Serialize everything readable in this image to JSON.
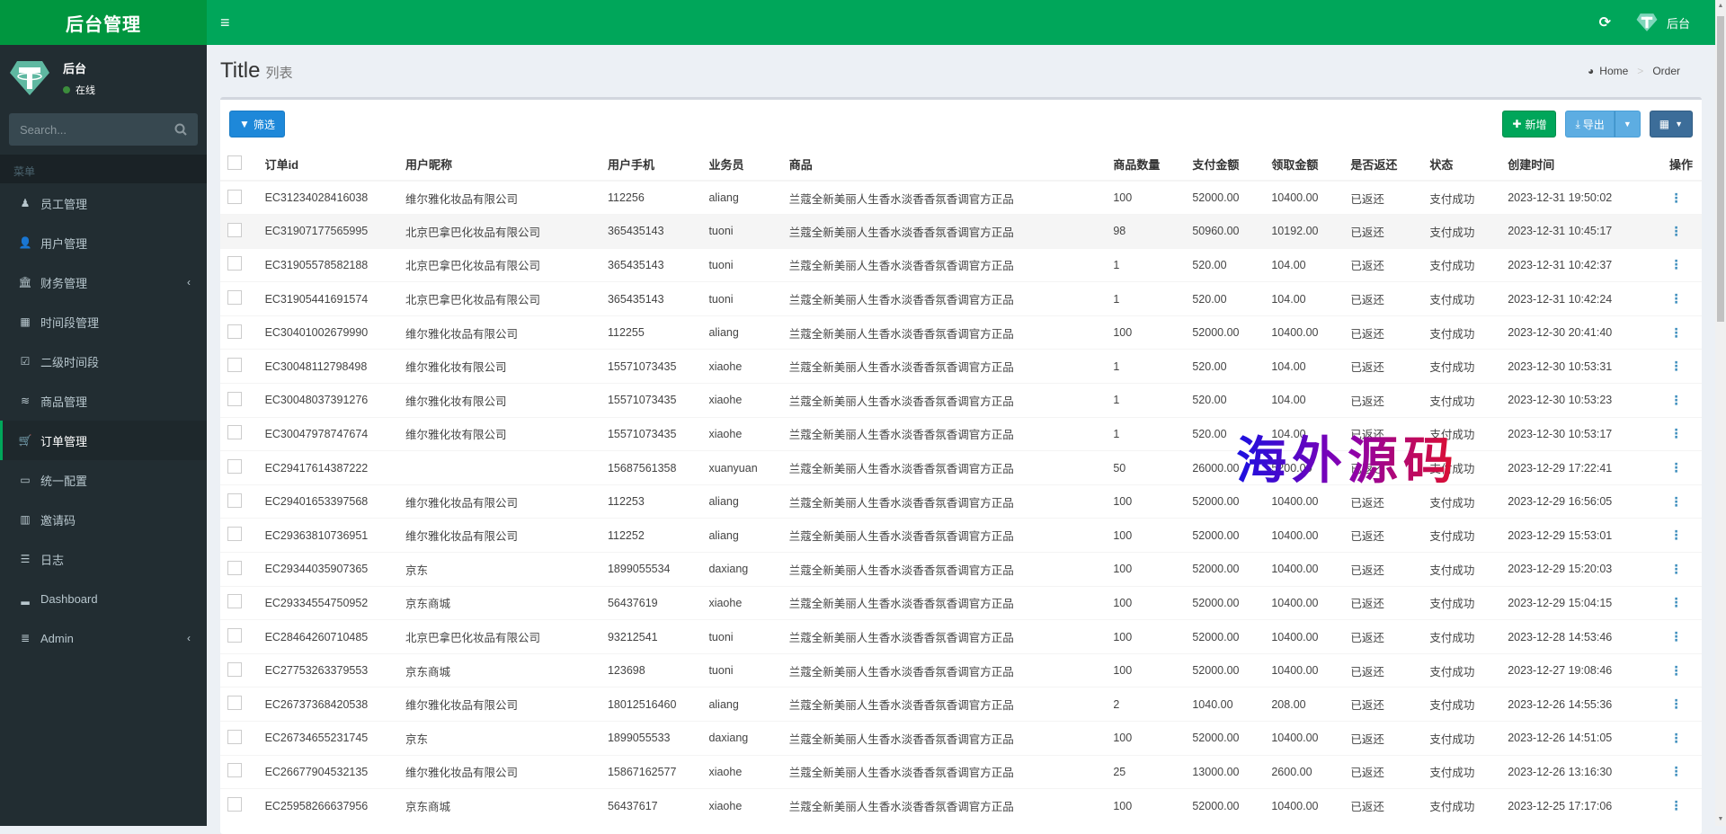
{
  "app": {
    "logo": "后台管理"
  },
  "user_panel": {
    "name": "后台",
    "status": "在线"
  },
  "sidebar": {
    "search_placeholder": "Search...",
    "header": "菜单",
    "items": [
      {
        "label": "员工管理",
        "icon": "user-tie-icon"
      },
      {
        "label": "用户管理",
        "icon": "user-icon"
      },
      {
        "label": "财务管理",
        "icon": "bank-icon",
        "chevron": "‹"
      },
      {
        "label": "时间段管理",
        "icon": "calendar-icon"
      },
      {
        "label": "二级时间段",
        "icon": "calendar-check-icon"
      },
      {
        "label": "商品管理",
        "icon": "database-icon"
      },
      {
        "label": "订单管理",
        "icon": "cart-icon",
        "active": true
      },
      {
        "label": "统一配置",
        "icon": "desktop-icon"
      },
      {
        "label": "邀请码",
        "icon": "building-icon"
      },
      {
        "label": "日志",
        "icon": "list-icon"
      },
      {
        "label": "Dashboard",
        "icon": "bar-chart-icon"
      },
      {
        "label": "Admin",
        "icon": "server-icon",
        "chevron": "‹"
      }
    ]
  },
  "topbar": {
    "user_name": "后台"
  },
  "page": {
    "title": "Title",
    "subtitle": "列表",
    "breadcrumb": [
      "Home",
      "Order"
    ]
  },
  "toolbar": {
    "filter_label": "筛选",
    "add_label": "新增",
    "export_label": "导出"
  },
  "table": {
    "columns": [
      "订单id",
      "用户昵称",
      "用户手机",
      "业务员",
      "商品",
      "商品数量",
      "支付金额",
      "领取金额",
      "是否返还",
      "状态",
      "创建时间",
      "操作"
    ],
    "rows": [
      [
        "EC31234028416038",
        "维尔雅化妆品有限公司",
        "112256",
        "aliang",
        "兰蔻全新美丽人生香水淡香香氛香调官方正品",
        "100",
        "52000.00",
        "10400.00",
        "已返还",
        "支付成功",
        "2023-12-31 19:50:02"
      ],
      [
        "EC31907177565995",
        "北京巴拿巴化妆品有限公司",
        "365435143",
        "tuoni",
        "兰蔻全新美丽人生香水淡香香氛香调官方正品",
        "98",
        "50960.00",
        "10192.00",
        "已返还",
        "支付成功",
        "2023-12-31 10:45:17"
      ],
      [
        "EC31905578582188",
        "北京巴拿巴化妆品有限公司",
        "365435143",
        "tuoni",
        "兰蔻全新美丽人生香水淡香香氛香调官方正品",
        "1",
        "520.00",
        "104.00",
        "已返还",
        "支付成功",
        "2023-12-31 10:42:37"
      ],
      [
        "EC31905441691574",
        "北京巴拿巴化妆品有限公司",
        "365435143",
        "tuoni",
        "兰蔻全新美丽人生香水淡香香氛香调官方正品",
        "1",
        "520.00",
        "104.00",
        "已返还",
        "支付成功",
        "2023-12-31 10:42:24"
      ],
      [
        "EC30401002679990",
        "维尔雅化妆品有限公司",
        "112255",
        "aliang",
        "兰蔻全新美丽人生香水淡香香氛香调官方正品",
        "100",
        "52000.00",
        "10400.00",
        "已返还",
        "支付成功",
        "2023-12-30 20:41:40"
      ],
      [
        "EC30048112798498",
        "维尔雅化妆有限公司",
        "15571073435",
        "xiaohe",
        "兰蔻全新美丽人生香水淡香香氛香调官方正品",
        "1",
        "520.00",
        "104.00",
        "已返还",
        "支付成功",
        "2023-12-30 10:53:31"
      ],
      [
        "EC30048037391276",
        "维尔雅化妆有限公司",
        "15571073435",
        "xiaohe",
        "兰蔻全新美丽人生香水淡香香氛香调官方正品",
        "1",
        "520.00",
        "104.00",
        "已返还",
        "支付成功",
        "2023-12-30 10:53:23"
      ],
      [
        "EC30047978747674",
        "维尔雅化妆有限公司",
        "15571073435",
        "xiaohe",
        "兰蔻全新美丽人生香水淡香香氛香调官方正品",
        "1",
        "520.00",
        "104.00",
        "已返还",
        "支付成功",
        "2023-12-30 10:53:17"
      ],
      [
        "EC29417614387222",
        "",
        "15687561358",
        "xuanyuan",
        "兰蔻全新美丽人生香水淡香香氛香调官方正品",
        "50",
        "26000.00",
        "5200.00",
        "已返还",
        "支付成功",
        "2023-12-29 17:22:41"
      ],
      [
        "EC29401653397568",
        "维尔雅化妆品有限公司",
        "112253",
        "aliang",
        "兰蔻全新美丽人生香水淡香香氛香调官方正品",
        "100",
        "52000.00",
        "10400.00",
        "已返还",
        "支付成功",
        "2023-12-29 16:56:05"
      ],
      [
        "EC29363810736951",
        "维尔雅化妆品有限公司",
        "112252",
        "aliang",
        "兰蔻全新美丽人生香水淡香香氛香调官方正品",
        "100",
        "52000.00",
        "10400.00",
        "已返还",
        "支付成功",
        "2023-12-29 15:53:01"
      ],
      [
        "EC29344035907365",
        "京东",
        "1899055534",
        "daxiang",
        "兰蔻全新美丽人生香水淡香香氛香调官方正品",
        "100",
        "52000.00",
        "10400.00",
        "已返还",
        "支付成功",
        "2023-12-29 15:20:03"
      ],
      [
        "EC29334554750952",
        "京东商城",
        "56437619",
        "xiaohe",
        "兰蔻全新美丽人生香水淡香香氛香调官方正品",
        "100",
        "52000.00",
        "10400.00",
        "已返还",
        "支付成功",
        "2023-12-29 15:04:15"
      ],
      [
        "EC28464260710485",
        "北京巴拿巴化妆品有限公司",
        "93212541",
        "tuoni",
        "兰蔻全新美丽人生香水淡香香氛香调官方正品",
        "100",
        "52000.00",
        "10400.00",
        "已返还",
        "支付成功",
        "2023-12-28 14:53:46"
      ],
      [
        "EC27753263379553",
        "京东商城",
        "123698",
        "tuoni",
        "兰蔻全新美丽人生香水淡香香氛香调官方正品",
        "100",
        "52000.00",
        "10400.00",
        "已返还",
        "支付成功",
        "2023-12-27 19:08:46"
      ],
      [
        "EC26737368420538",
        "维尔雅化妆品有限公司",
        "18012516460",
        "aliang",
        "兰蔻全新美丽人生香水淡香香氛香调官方正品",
        "2",
        "1040.00",
        "208.00",
        "已返还",
        "支付成功",
        "2023-12-26 14:55:36"
      ],
      [
        "EC26734655231745",
        "京东",
        "1899055533",
        "daxiang",
        "兰蔻全新美丽人生香水淡香香氛香调官方正品",
        "100",
        "52000.00",
        "10400.00",
        "已返还",
        "支付成功",
        "2023-12-26 14:51:05"
      ],
      [
        "EC26677904532135",
        "维尔雅化妆品有限公司",
        "15867162577",
        "xiaohe",
        "兰蔻全新美丽人生香水淡香香氛香调官方正品",
        "25",
        "13000.00",
        "2600.00",
        "已返还",
        "支付成功",
        "2023-12-26 13:16:30"
      ],
      [
        "EC25958266637956",
        "京东商城",
        "56437617",
        "xiaohe",
        "兰蔻全新美丽人生香水淡香香氛香调官方正品",
        "100",
        "52000.00",
        "10400.00",
        "已返还",
        "支付成功",
        "2023-12-25 17:17:06"
      ]
    ],
    "highlighted_row": 1
  },
  "watermark": "海外源码",
  "colors": {
    "brand": "#00a65a",
    "sidebar": "#222d32",
    "filter": "#1e88d9",
    "export": "#5dade2",
    "columns": "#3c6d99"
  }
}
